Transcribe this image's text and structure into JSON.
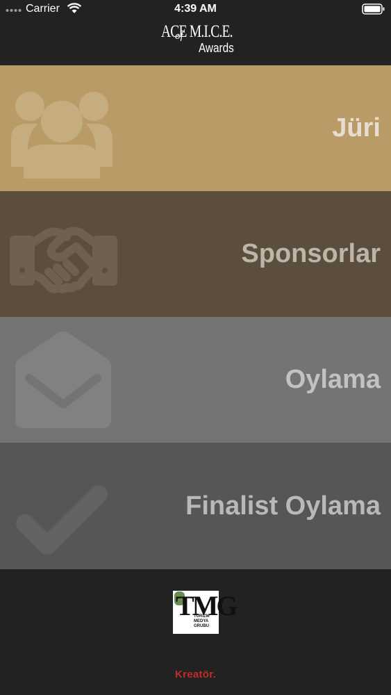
{
  "status_bar": {
    "carrier": "Carrier",
    "time": "4:39 AM"
  },
  "logo": {
    "main": "ACE M.I.C.E.",
    "of": "of",
    "sub": "Awards"
  },
  "menu": {
    "items": [
      {
        "label": "Jüri",
        "icon": "group-people-icon"
      },
      {
        "label": "Sponsorlar",
        "icon": "handshake-icon"
      },
      {
        "label": "Oylama",
        "icon": "envelope-icon"
      },
      {
        "label": "Finalist Oylama",
        "icon": "checkmark-icon"
      }
    ]
  },
  "footer": {
    "partner_logo": {
      "letters": "TMG",
      "tagline": [
        "TURİZM",
        "MEDYA",
        "GRUBU"
      ]
    },
    "developer": "Kreatör."
  },
  "colors": {
    "juri_bg": "#b99b68",
    "sponsor_bg": "#5c4e3d",
    "oylama_bg": "#727573",
    "finalist_bg": "#565656",
    "dark_bg": "#222222",
    "developer_red": "#c22b2b"
  }
}
